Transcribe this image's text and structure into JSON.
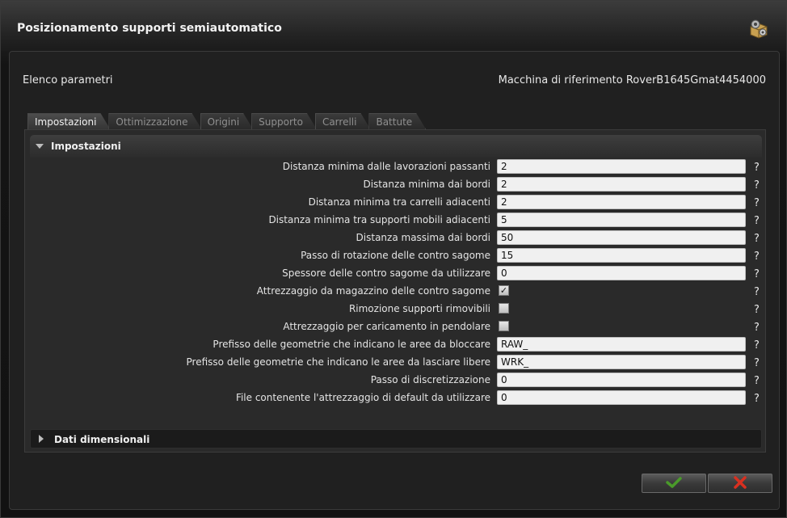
{
  "window": {
    "title": "Posizionamento supporti semiautomatico",
    "title_icon": "gear-box-icon"
  },
  "header": {
    "left_label": "Elenco parametri",
    "right_label": "Macchina di riferimento RoverB1645Gmat4454000"
  },
  "tabs": [
    {
      "label": "Impostazioni",
      "active": true
    },
    {
      "label": "Ottimizzazione",
      "active": false
    },
    {
      "label": "Origini",
      "active": false
    },
    {
      "label": "Supporto",
      "active": false
    },
    {
      "label": "Carrelli",
      "active": false
    },
    {
      "label": "Battute",
      "active": false
    }
  ],
  "section": {
    "title": "Impostazioni",
    "help_symbol": "?",
    "rows": [
      {
        "label": "Distanza minima dalle lavorazioni passanti",
        "type": "text",
        "value": "2"
      },
      {
        "label": "Distanza minima dai bordi",
        "type": "text",
        "value": "2"
      },
      {
        "label": "Distanza minima tra carrelli adiacenti",
        "type": "text",
        "value": "2"
      },
      {
        "label": "Distanza minima tra supporti mobili adiacenti",
        "type": "text",
        "value": "5"
      },
      {
        "label": "Distanza massima dai bordi",
        "type": "text",
        "value": "50"
      },
      {
        "label": "Passo di rotazione delle contro sagome",
        "type": "text",
        "value": "15"
      },
      {
        "label": "Spessore delle contro sagome da utilizzare",
        "type": "text",
        "value": "0"
      },
      {
        "label": "Attrezzaggio da magazzino delle contro sagome",
        "type": "checkbox",
        "checked": true
      },
      {
        "label": "Rimozione supporti rimovibili",
        "type": "checkbox",
        "checked": false
      },
      {
        "label": "Attrezzaggio per caricamento in pendolare",
        "type": "checkbox",
        "checked": false
      },
      {
        "label": "Prefisso delle geometrie che indicano le aree da bloccare",
        "type": "text",
        "value": "RAW_"
      },
      {
        "label": "Prefisso delle geometrie che indicano le aree da lasciare libere",
        "type": "text",
        "value": "WRK_"
      },
      {
        "label": "Passo di discretizzazione",
        "type": "text",
        "value": "0"
      },
      {
        "label": "File contenente l'attrezzaggio di default da utilizzare",
        "type": "text",
        "value": "0"
      }
    ]
  },
  "collapsed_section": {
    "title": "Dati dimensionali"
  },
  "buttons": {
    "ok_icon": "checkmark-icon",
    "cancel_icon": "close-x-icon",
    "ok_color": "#4a9a2a",
    "cancel_color": "#d83020"
  }
}
